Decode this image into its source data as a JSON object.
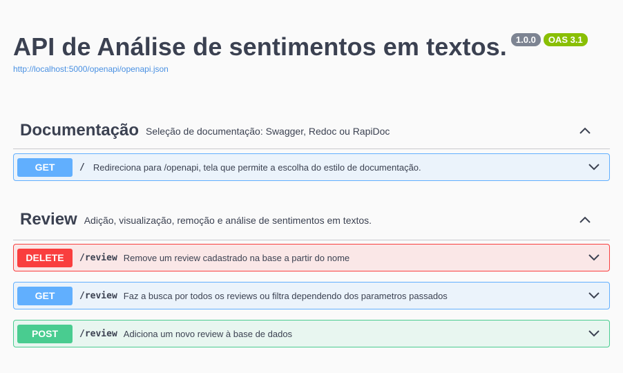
{
  "info": {
    "title": "API de Análise de sentimentos em textos.",
    "version": "1.0.0",
    "oas": "OAS 3.1",
    "spec_url": "http://localhost:5000/openapi/openapi.json"
  },
  "tags": [
    {
      "name": "Documentação",
      "description": "Seleção de documentação: Swagger, Redoc ou RapiDoc",
      "operations": [
        {
          "method": "GET",
          "path": "/",
          "summary": "Redireciona para /openapi, tela que permite a escolha do estilo de documentação."
        }
      ]
    },
    {
      "name": "Review",
      "description": "Adição, visualização, remoção e análise de sentimentos em textos.",
      "operations": [
        {
          "method": "DELETE",
          "path": "/review",
          "summary": "Remove um review cadastrado na base a partir do nome"
        },
        {
          "method": "GET",
          "path": "/review",
          "summary": "Faz a busca por todos os reviews ou filtra dependendo dos parametros passados"
        },
        {
          "method": "POST",
          "path": "/review",
          "summary": "Adiciona um novo review à base de dados"
        }
      ]
    }
  ],
  "icons": {
    "tag_toggle": "chevron-up-icon",
    "op_toggle": "chevron-down-icon"
  },
  "colors": {
    "get": "#61affe",
    "delete": "#f93e3e",
    "post": "#49cc90",
    "version_badge": "#7d8492",
    "oas_badge": "#89bf04",
    "link": "#4990e2"
  }
}
